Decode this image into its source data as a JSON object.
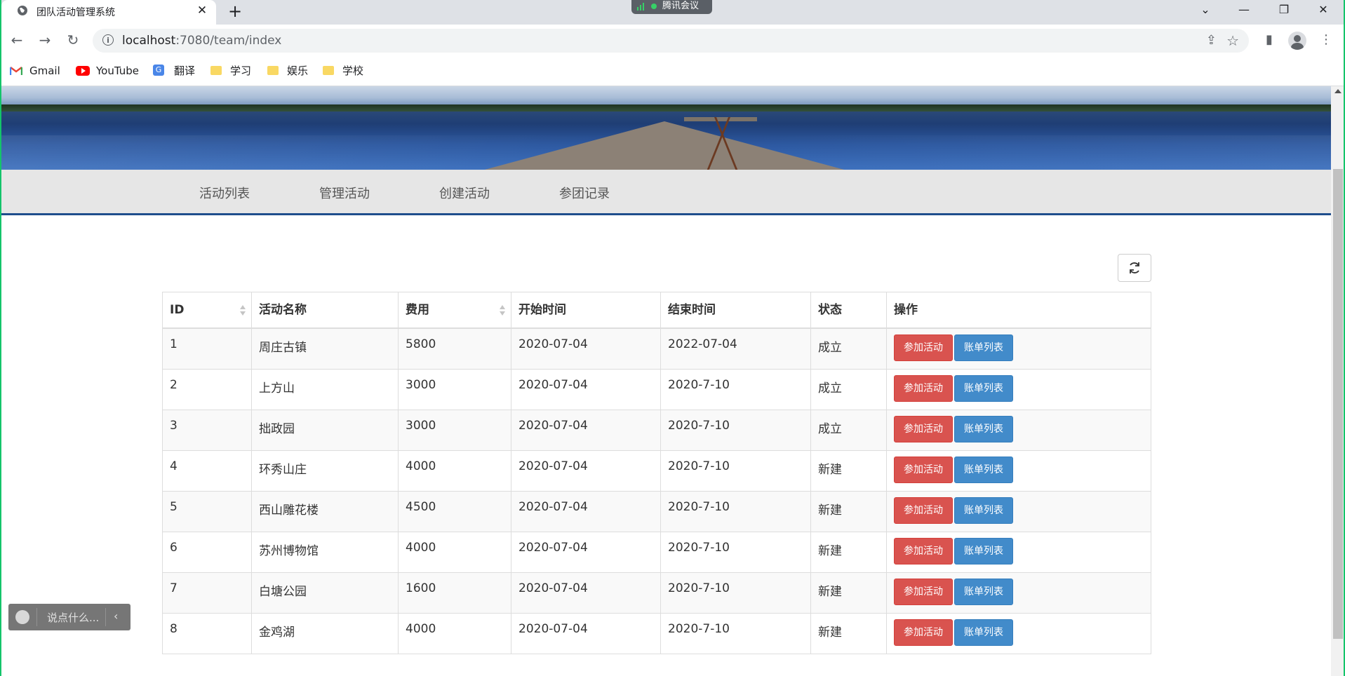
{
  "browser": {
    "tab_title": "团队活动管理系统",
    "tab_close": "✕",
    "new_tab": "+",
    "meeting_label": "腾讯会议",
    "url_host": "localhost",
    "url_path": ":7080/team/index",
    "window_controls": {
      "minimize": "—",
      "restore": "❐",
      "close": "✕",
      "tabs_dropdown": "⌄"
    }
  },
  "bookmarks": [
    {
      "label": "Gmail",
      "icon": "gmail-icon"
    },
    {
      "label": "YouTube",
      "icon": "youtube-icon"
    },
    {
      "label": "翻译",
      "icon": "translate-icon"
    },
    {
      "label": "学习",
      "icon": "folder-icon"
    },
    {
      "label": "娱乐",
      "icon": "folder-icon"
    },
    {
      "label": "学校",
      "icon": "folder-icon"
    }
  ],
  "nav": {
    "items": [
      "活动列表",
      "管理活动",
      "创建活动",
      "参团记录"
    ]
  },
  "table": {
    "columns": [
      "ID",
      "活动名称",
      "费用",
      "开始时间",
      "结束时间",
      "状态",
      "操作"
    ],
    "rows": [
      {
        "id": "1",
        "name": "周庄古镇",
        "fee": "5800",
        "start": "2020-07-04",
        "end": "2022-07-04",
        "status": "成立"
      },
      {
        "id": "2",
        "name": "上方山",
        "fee": "3000",
        "start": "2020-07-04",
        "end": "2020-7-10",
        "status": "成立"
      },
      {
        "id": "3",
        "name": "拙政园",
        "fee": "3000",
        "start": "2020-07-04",
        "end": "2020-7-10",
        "status": "成立"
      },
      {
        "id": "4",
        "name": "环秀山庄",
        "fee": "4000",
        "start": "2020-07-04",
        "end": "2020-7-10",
        "status": "新建"
      },
      {
        "id": "5",
        "name": "西山雕花楼",
        "fee": "4500",
        "start": "2020-07-04",
        "end": "2020-7-10",
        "status": "新建"
      },
      {
        "id": "6",
        "name": "苏州博物馆",
        "fee": "4000",
        "start": "2020-07-04",
        "end": "2020-7-10",
        "status": "新建"
      },
      {
        "id": "7",
        "name": "白塘公园",
        "fee": "1600",
        "start": "2020-07-04",
        "end": "2020-7-10",
        "status": "新建"
      },
      {
        "id": "8",
        "name": "金鸡湖",
        "fee": "4000",
        "start": "2020-07-04",
        "end": "2020-7-10",
        "status": "新建"
      }
    ],
    "join_label": "参加活动",
    "bills_label": "账单列表"
  },
  "chat": {
    "placeholder": "说点什么..."
  },
  "colors": {
    "accent": "#1f4e8c",
    "join_button": "#d9534f",
    "bills_button": "#428bca",
    "nav_bg": "#e6e6e6"
  }
}
